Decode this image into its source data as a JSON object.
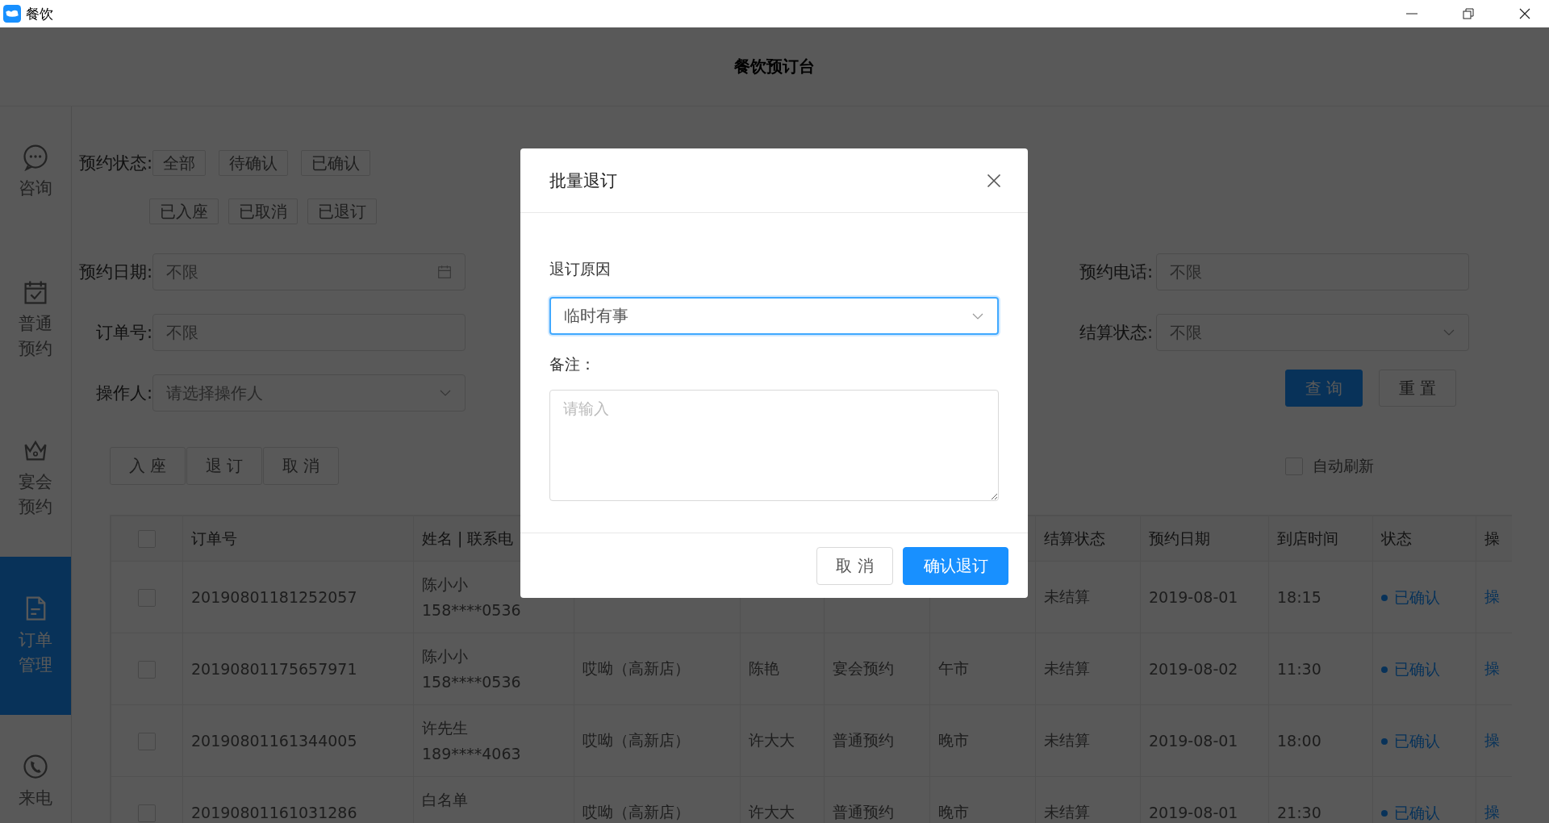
{
  "window": {
    "title": "餐饮"
  },
  "header": {
    "title": "餐饮预订台"
  },
  "sidebar": {
    "items": [
      {
        "label": "咨询",
        "selected": false
      },
      {
        "label": "普通预约",
        "selected": false
      },
      {
        "label": "宴会预约",
        "selected": false
      },
      {
        "label": "订单管理",
        "selected": true
      },
      {
        "label": "来电",
        "selected": false
      }
    ]
  },
  "filters": {
    "status_row": {
      "label": "预约状态:",
      "options": [
        "全部",
        "待确认",
        "已确认",
        "已入座",
        "已取消",
        "已退订"
      ]
    },
    "date": {
      "label": "预约日期:",
      "placeholder": "不限"
    },
    "phone": {
      "label": "预约电话:",
      "placeholder": "不限"
    },
    "order_no": {
      "label": "订单号:",
      "placeholder": "不限"
    },
    "settlement": {
      "label": "结算状态:",
      "placeholder": "不限"
    },
    "operator": {
      "label": "操作人:",
      "placeholder": "请选择操作人"
    },
    "buttons": [
      {
        "label": "查 询",
        "kind": "primary"
      },
      {
        "label": "重 置",
        "kind": "default"
      }
    ]
  },
  "actions": [
    "入 座",
    "退 订",
    "取 消"
  ],
  "auto_refresh": {
    "label": "自动刷新",
    "checked": false
  },
  "table": {
    "header_checked": false,
    "columns": [
      "订单号",
      "姓名 | 联系电",
      "结算状态",
      "预约日期",
      "到店时间",
      "状态",
      "操"
    ],
    "rows": [
      {
        "checked": false,
        "order": "20190801181252057",
        "name": "陈小小",
        "phone": "158****0536",
        "settlement": "未结算",
        "date": "2019-08-01",
        "time": "18:15",
        "status": "已确认",
        "action": "操"
      },
      {
        "checked": false,
        "order": "20190801175657971",
        "name": "陈小小",
        "phone": "158****0536",
        "store": "哎呦（高新店）",
        "receptionist": "陈艳",
        "type": "宴会预约",
        "period": "午市",
        "settlement": "未结算",
        "date": "2019-08-02",
        "time": "11:30",
        "status": "已确认",
        "action": "操"
      },
      {
        "checked": false,
        "order": "20190801161344005",
        "name": "许先生",
        "phone": "189****4063",
        "store": "哎呦（高新店）",
        "receptionist": "许大大",
        "type": "普通预约",
        "period": "晚市",
        "settlement": "未结算",
        "date": "2019-08-01",
        "time": "18:00",
        "status": "已确认",
        "action": "操"
      },
      {
        "checked": false,
        "order": "20190801161031286",
        "name": "白名单",
        "store": "哎呦（高新店）",
        "receptionist": "许大大",
        "type": "普通预约",
        "period": "晚市",
        "settlement": "未结算",
        "date": "2019-08-01",
        "time": "21:30",
        "status": "已确认",
        "action": "操"
      }
    ]
  },
  "dialog": {
    "title": "批量退订",
    "reason_label": "退订原因",
    "reason_value": "临时有事",
    "note_label": "备注：",
    "note_placeholder": "请输入",
    "buttons": [
      {
        "label": "取 消",
        "kind": "default"
      },
      {
        "label": "确认退订",
        "kind": "primary"
      }
    ]
  }
}
